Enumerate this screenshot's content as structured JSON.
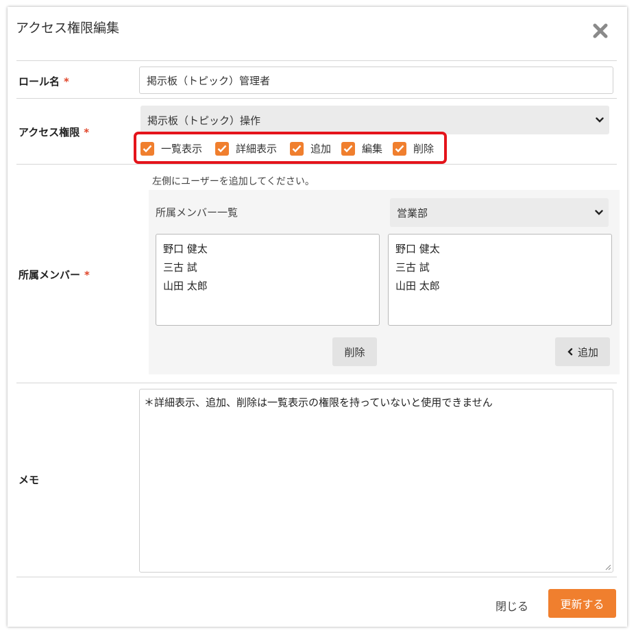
{
  "dialog": {
    "title": "アクセス権限編集"
  },
  "role": {
    "label": "ロール名",
    "required_mark": "*",
    "value": "掲示板（トピック）管理者"
  },
  "access": {
    "label": "アクセス権限",
    "required_mark": "*",
    "select_value": "掲示板（トピック）操作",
    "permissions": [
      {
        "label": "一覧表示",
        "checked": true
      },
      {
        "label": "詳細表示",
        "checked": true
      },
      {
        "label": "追加",
        "checked": true
      },
      {
        "label": "編集",
        "checked": true
      },
      {
        "label": "削除",
        "checked": true
      }
    ],
    "highlight_color": "#e4141b"
  },
  "members": {
    "label": "所属メンバー",
    "required_mark": "*",
    "hint": "左側にユーザーを追加してください。",
    "panel_title": "所属メンバー一覧",
    "department_select": "営業部",
    "left_list": [
      "野口 健太",
      "三古 試",
      "山田 太郎"
    ],
    "right_list": [
      "野口 健太",
      "三古 試",
      "山田 太郎"
    ],
    "delete_button": "削除",
    "add_button": "追加"
  },
  "memo": {
    "label": "メモ",
    "value": "＊詳細表示、追加、削除は一覧表示の権限を持っていないと使用できません"
  },
  "footer": {
    "close_label": "閉じる",
    "submit_label": "更新する"
  },
  "colors": {
    "accent": "#f07f2e",
    "required": "#e0452a"
  }
}
